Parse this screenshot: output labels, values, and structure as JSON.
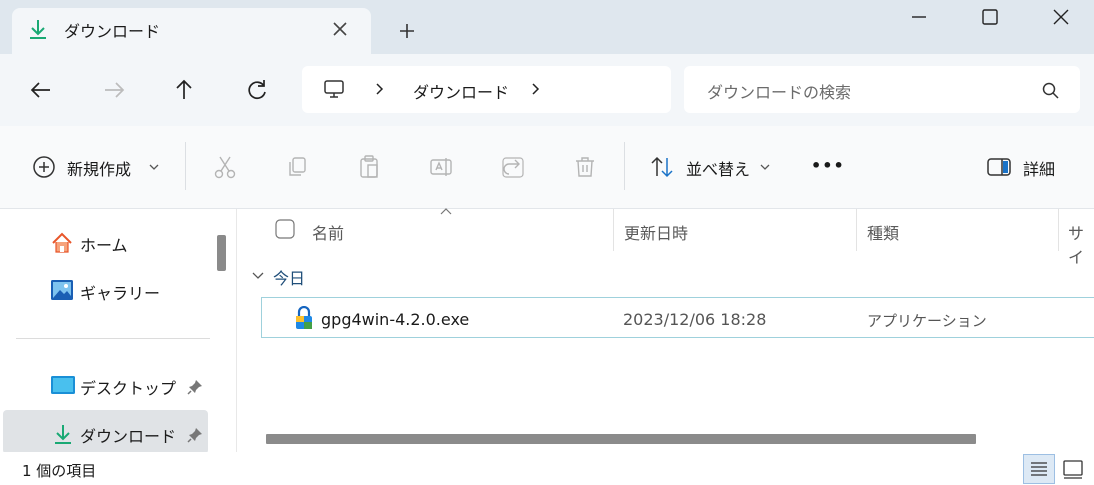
{
  "window": {
    "tab_title": "ダウンロード",
    "tab_icon": "download-arrow-icon",
    "controls": [
      "minimize-icon",
      "maximize-icon",
      "close-icon"
    ]
  },
  "nav": {
    "buttons": [
      "back-arrow-icon",
      "forward-arrow-icon",
      "up-arrow-icon",
      "refresh-icon"
    ],
    "breadcrumb": {
      "location": "ダウンロード"
    },
    "search": {
      "placeholder": "ダウンロードの検索"
    }
  },
  "toolbar": {
    "new_label": "新規作成",
    "sort_label": "並べ替え",
    "more_label": "•••",
    "details_label": "詳細"
  },
  "sidebar": {
    "items": [
      {
        "label": "ホーム",
        "icon": "home-icon"
      },
      {
        "label": "ギャラリー",
        "icon": "gallery-icon"
      },
      {
        "label": "デスクトップ",
        "icon": "desktop-icon",
        "pinned": true
      },
      {
        "label": "ダウンロード",
        "icon": "download-icon",
        "pinned": true,
        "selected": true
      }
    ]
  },
  "columns": {
    "name": "名前",
    "modified": "更新日時",
    "type": "種類",
    "size": "サイ"
  },
  "group": {
    "label": "今日"
  },
  "files": [
    {
      "name": "gpg4win-4.2.0.exe",
      "modified": "2023/12/06 18:28",
      "type": "アプリケーション",
      "icon": "installer-icon"
    }
  ],
  "status": {
    "count": "1 個の項目"
  },
  "colors": {
    "accent_green": "#2bb67c",
    "selection_border": "#9fd1dc",
    "sidebar_selected": "#e0e3e6"
  }
}
